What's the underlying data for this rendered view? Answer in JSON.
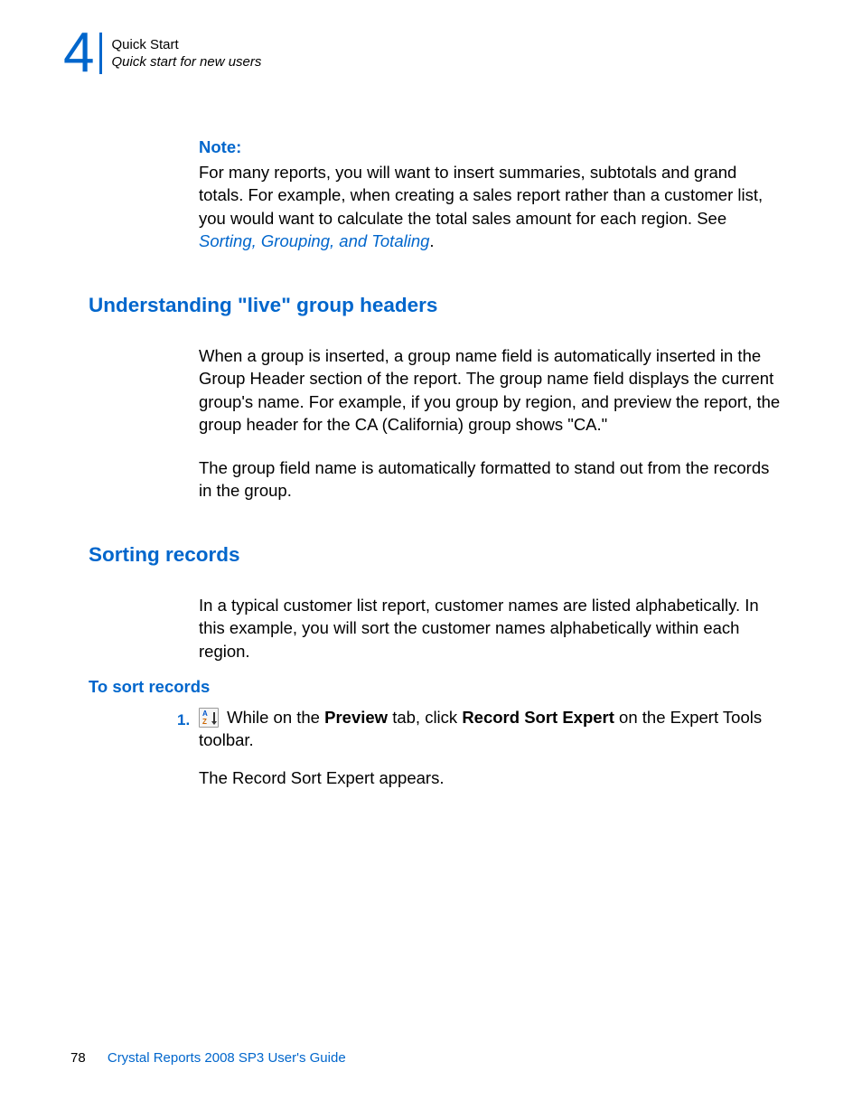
{
  "header": {
    "chapter_number": "4",
    "line1": "Quick Start",
    "line2": "Quick start for new users"
  },
  "note": {
    "label": "Note:",
    "body_pre": "For many reports, you will want to insert summaries, subtotals and grand totals. For example, when creating a sales report rather than a customer list, you would want to calculate the total sales amount for each region. See ",
    "link": "Sorting, Grouping, and Totaling",
    "body_post": "."
  },
  "section1": {
    "heading": "Understanding \"live\" group headers",
    "p1": "When a group is inserted, a group name field is automatically inserted in the Group Header section of the report. The group name field displays the current group's name. For example, if you group by region, and preview the report, the group header for the CA (California) group shows \"CA.\"",
    "p2": "The group field name is automatically formatted to stand out from the records in the group."
  },
  "section2": {
    "heading": "Sorting records",
    "p1": "In a typical customer list report, customer names are listed alphabetically. In this example, you will sort the customer names alphabetically within each region.",
    "sub": "To sort records",
    "step1_num": "1.",
    "step1_a": " While on the ",
    "step1_b": "Preview",
    "step1_c": " tab, click ",
    "step1_d": "Record Sort Expert",
    "step1_e": " on the Expert Tools toolbar.",
    "step1_result": "The Record Sort Expert appears."
  },
  "footer": {
    "page": "78",
    "title": "Crystal Reports 2008 SP3 User's Guide"
  }
}
